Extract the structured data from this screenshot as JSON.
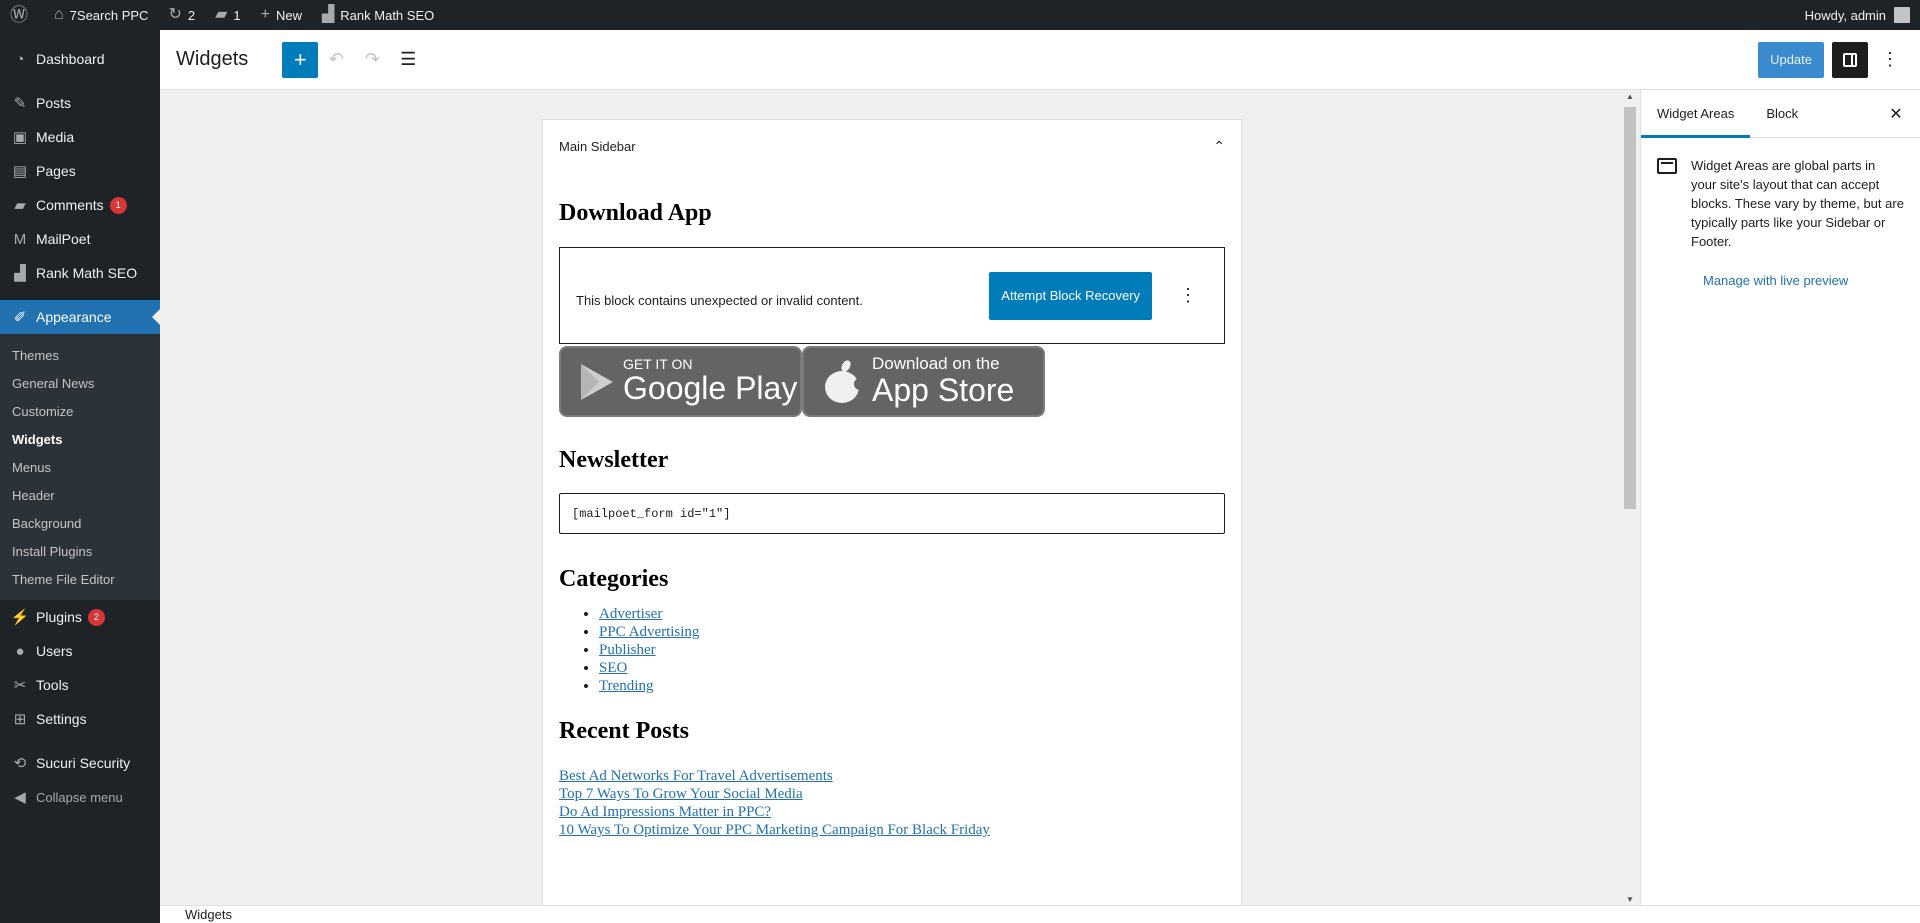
{
  "adminbar": {
    "site_name": "7Search PPC",
    "updates_count": "2",
    "comments_count": "1",
    "new_label": "New",
    "rankmath_label": "Rank Math SEO",
    "howdy": "Howdy, admin"
  },
  "menu": {
    "dashboard": "Dashboard",
    "posts": "Posts",
    "media": "Media",
    "pages": "Pages",
    "comments": "Comments",
    "comments_badge": "1",
    "mailpoet": "MailPoet",
    "rankmath": "Rank Math SEO",
    "appearance": "Appearance",
    "appearance_sub": [
      "Themes",
      "General News",
      "Customize",
      "Widgets",
      "Menus",
      "Header",
      "Background",
      "Install Plugins",
      "Theme File Editor"
    ],
    "plugins": "Plugins",
    "plugins_badge": "2",
    "users": "Users",
    "tools": "Tools",
    "settings": "Settings",
    "sucuri": "Sucuri Security",
    "collapse": "Collapse menu"
  },
  "header": {
    "title": "Widgets",
    "update_label": "Update"
  },
  "widget_area": {
    "title": "Main Sidebar",
    "download_heading": "Download App",
    "invalid_text": "This block contains unexpected or invalid content.",
    "recovery_label": "Attempt Block Recovery",
    "play_small": "GET IT ON",
    "play_big": "Google Play",
    "apple_small": "Download on the",
    "apple_big": "App Store",
    "newsletter_heading": "Newsletter",
    "shortcode": "[mailpoet_form id=\"1\"]",
    "categories_heading": "Categories",
    "categories": [
      "Advertiser",
      "PPC Advertising",
      "Publisher",
      "SEO",
      "Trending"
    ],
    "recent_heading": "Recent Posts",
    "recent_posts": [
      "Best Ad Networks For Travel Advertisements",
      "Top 7 Ways To Grow Your Social Media",
      "Do Ad Impressions Matter in PPC?",
      "10 Ways To Optimize Your PPC Marketing Campaign For Black Friday"
    ]
  },
  "sidebar": {
    "tab_widget_areas": "Widget Areas",
    "tab_block": "Block",
    "description": "Widget Areas are global parts in your site's layout that can accept blocks. These vary by theme, but are typically parts like your Sidebar or Footer.",
    "manage_link": "Manage with live preview"
  },
  "footer": {
    "breadcrumb": "Widgets"
  },
  "colors": {
    "accent": "#007cba",
    "admin_dark": "#1d2327",
    "menu_current": "#2271b1",
    "badge": "#d63638"
  }
}
